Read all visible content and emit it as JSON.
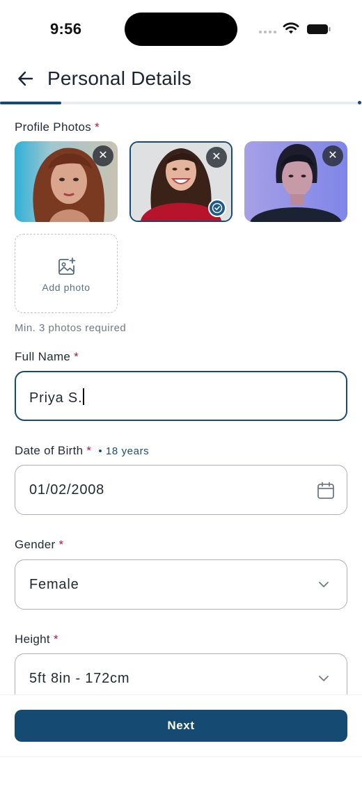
{
  "status": {
    "time": "9:56"
  },
  "header": {
    "title": "Personal Details"
  },
  "progress": {
    "value": 0.17
  },
  "photos": {
    "label": "Profile Photos",
    "required_mark": "*",
    "remove_glyph": "✕",
    "add_label": "Add photo",
    "hint": "Min. 3 photos required",
    "items": [
      {
        "selected": false
      },
      {
        "selected": true
      },
      {
        "selected": false
      }
    ]
  },
  "full_name": {
    "label": "Full Name",
    "required_mark": "*",
    "value": "Priya S."
  },
  "dob": {
    "label": "Date of Birth",
    "required_mark": "*",
    "age": "• 18 years",
    "value": "01/02/2008",
    "icon": "calendar-icon"
  },
  "gender": {
    "label": "Gender",
    "required_mark": "*",
    "value": "Female",
    "icon": "chevron-down-icon"
  },
  "height": {
    "label": "Height",
    "required_mark": "*",
    "value": "5ft 8in - 172cm",
    "icon": "chevron-down-icon"
  },
  "footer": {
    "next_label": "Next"
  },
  "colors": {
    "primary": "#154a72",
    "required": "#b0163a",
    "border": "#a8b1ba"
  }
}
